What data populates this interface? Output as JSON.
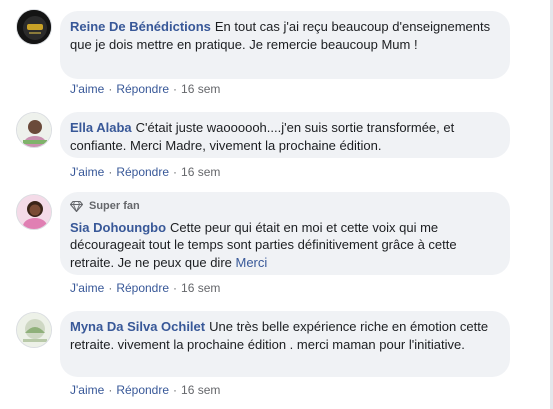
{
  "comments": [
    {
      "author": "Reine De Bénédictions",
      "badge": "",
      "text": "En tout cas j'ai reçu beaucoup d'enseignements que je dois mettre en pratique. Je remercie beaucoup Mum !",
      "link": "",
      "like": "J'aime",
      "reply": "Répondre",
      "sep": "·",
      "time": "16 sem"
    },
    {
      "author": "Ella Alaba",
      "badge": "",
      "text": "C'était juste waoooooh....j'en suis sortie transformée, et confiante. Merci Madre, vivement la prochaine édition.",
      "link": "",
      "like": "J'aime",
      "reply": "Répondre",
      "sep": "·",
      "time": "16 sem"
    },
    {
      "author": "Sia Dohoungbo",
      "badge": "Super fan",
      "text": "Cette peur qui était en moi et cette voix qui me décourageait tout le temps sont parties définitivement grâce à cette retraite. Je ne peux que dire ",
      "link": "Merci",
      "like": "J'aime",
      "reply": "Répondre",
      "sep": "·",
      "time": "16 sem"
    },
    {
      "author": "Myna Da Silva Ochilet",
      "badge": "",
      "text": "Une très belle expérience riche en émotion cette retraite. vivement la prochaine édition . merci maman pour l'initiative.",
      "link": "",
      "like": "J'aime",
      "reply": "Répondre",
      "sep": "·",
      "time": "16 sem"
    }
  ],
  "colors": {
    "link": "#385898",
    "bubble": "#f0f2f5",
    "muted": "#65676b"
  },
  "icons": {
    "badge": "diamond-icon"
  }
}
